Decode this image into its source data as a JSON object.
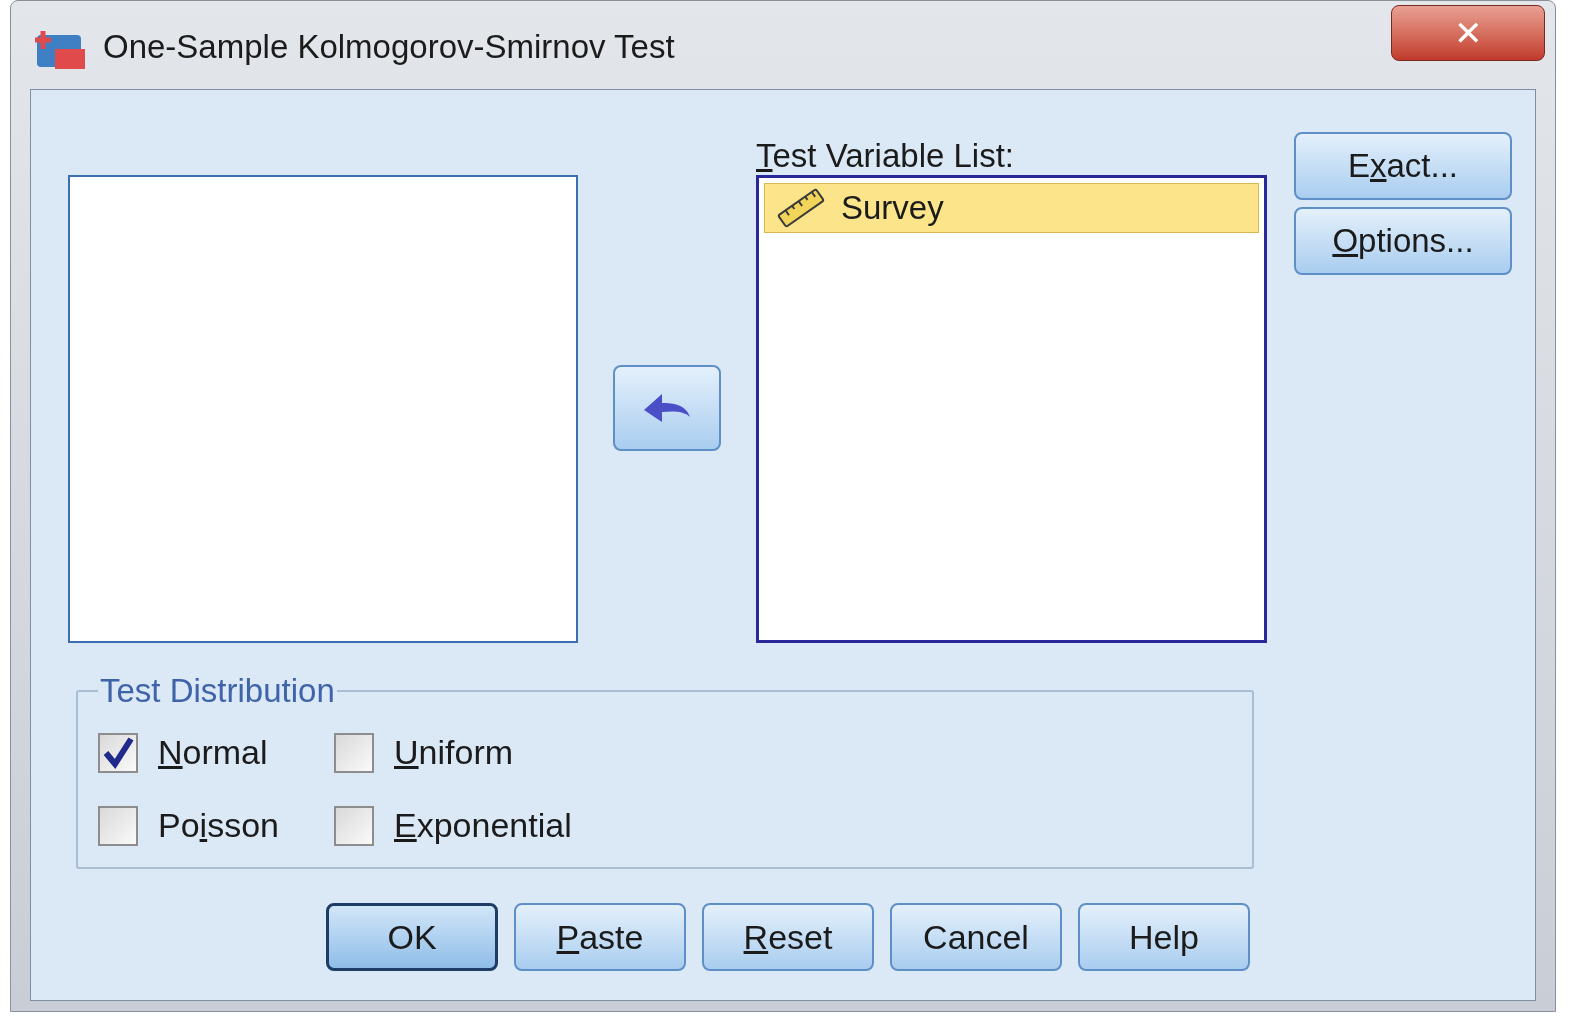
{
  "window": {
    "title": "One-Sample Kolmogorov-Smirnov Test",
    "close": "✕"
  },
  "test_variable_list": {
    "label": {
      "key": "T",
      "after": "est Variable List:"
    },
    "items": [
      {
        "name": "Survey",
        "selected": true
      }
    ]
  },
  "side_buttons": [
    {
      "before": "E",
      "key": "x",
      "after": "act..."
    },
    {
      "key": "O",
      "after": "ptions..."
    }
  ],
  "test_distribution": {
    "title": "Test Distribution",
    "options": [
      {
        "key": "N",
        "after": "ormal",
        "checked": true
      },
      {
        "key": "U",
        "after": "niform",
        "checked": false
      },
      {
        "before": "Po",
        "key": "i",
        "after": "sson",
        "checked": false
      },
      {
        "key": "E",
        "after": "xponential",
        "checked": false
      }
    ]
  },
  "buttons": [
    {
      "after": "OK",
      "default": true
    },
    {
      "key": "P",
      "after": "aste",
      "default": false
    },
    {
      "key": "R",
      "after": "eset",
      "default": false
    },
    {
      "after": "Cancel",
      "default": false
    },
    {
      "after": "Help",
      "default": false
    }
  ]
}
